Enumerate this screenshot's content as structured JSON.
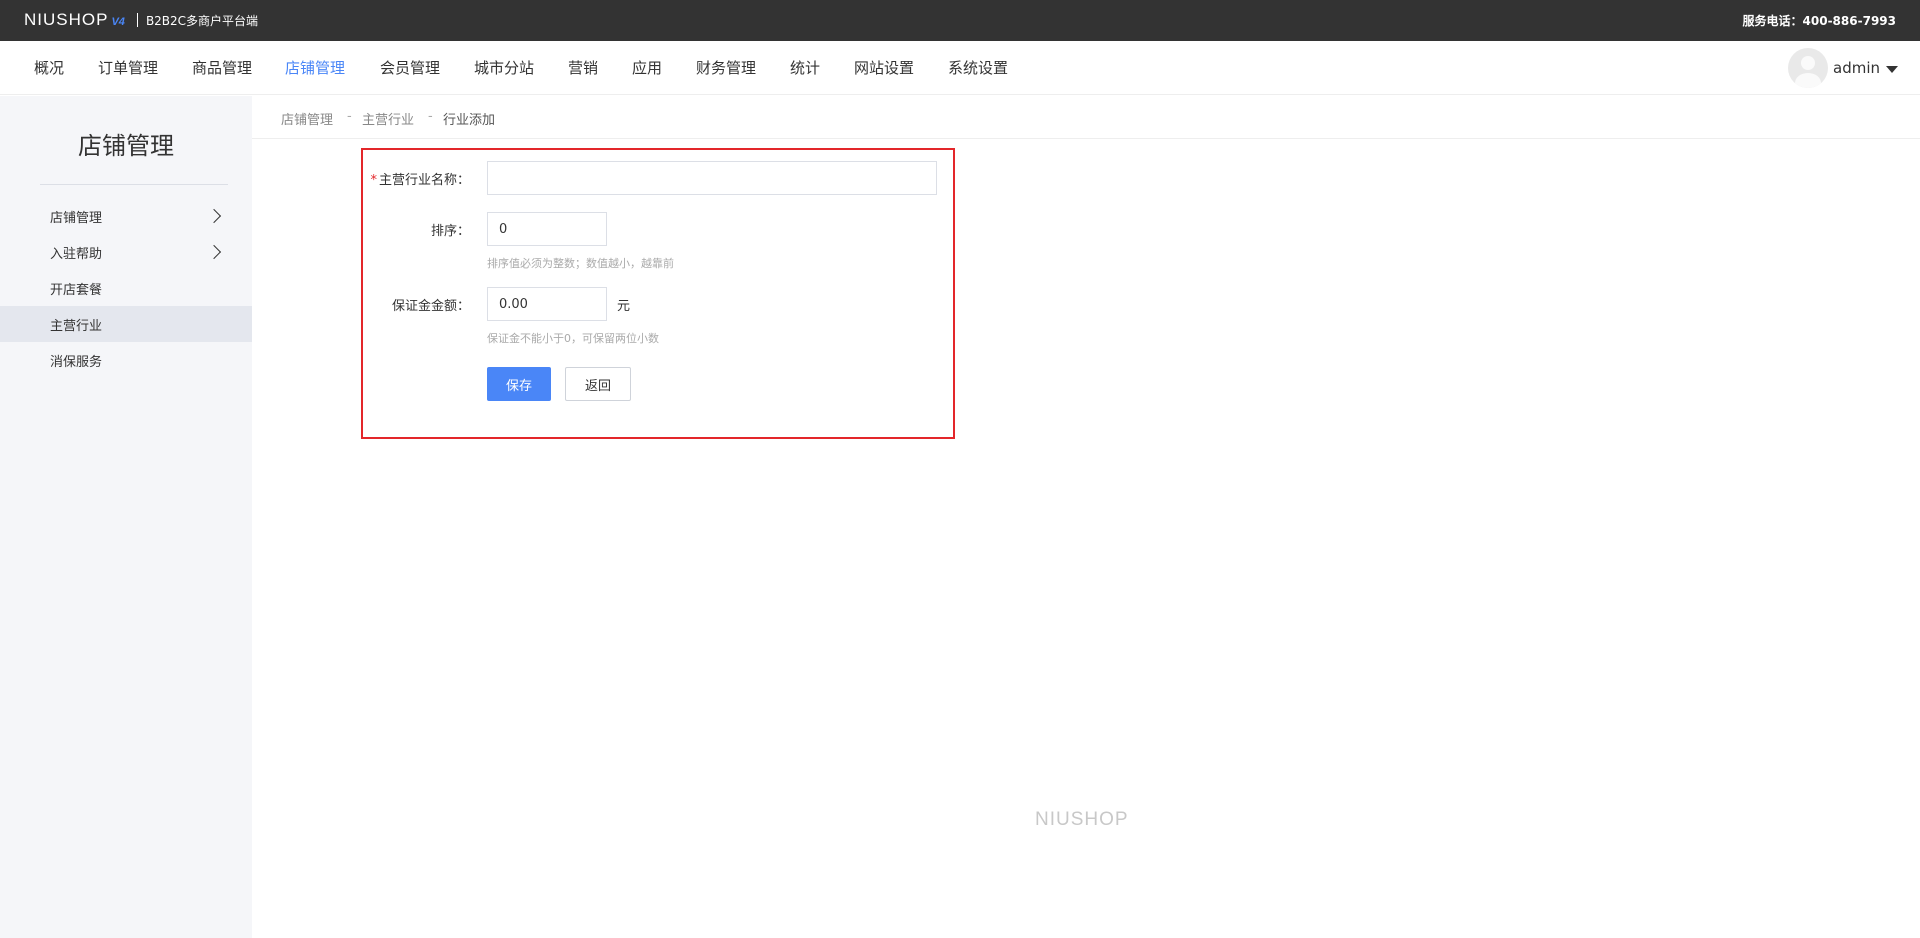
{
  "topbar": {
    "logo_text": "NIUSHOP",
    "logo_version": "V4",
    "subtitle": "B2B2C多商户平台端",
    "hotline": "服务电话：400-886-7993"
  },
  "nav": {
    "items": [
      "概况",
      "订单管理",
      "商品管理",
      "店铺管理",
      "会员管理",
      "城市分站",
      "营销",
      "应用",
      "财务管理",
      "统计",
      "网站设置",
      "系统设置"
    ],
    "active": "店铺管理",
    "user_name": "admin"
  },
  "sidebar": {
    "title": "店铺管理",
    "items": [
      {
        "label": "店铺管理",
        "has_children": true
      },
      {
        "label": "入驻帮助",
        "has_children": true
      },
      {
        "label": "开店套餐",
        "has_children": false
      },
      {
        "label": "主营行业",
        "has_children": false,
        "active": true
      },
      {
        "label": "消保服务",
        "has_children": false
      }
    ]
  },
  "breadcrumb": {
    "items": [
      "店铺管理",
      "主营行业",
      "行业添加"
    ],
    "separator": "-"
  },
  "form": {
    "name_label": "主营行业名称：",
    "name_required_mark": "*",
    "name_value": "",
    "sort_label": "排序：",
    "sort_value": "0",
    "sort_hint": "排序值必须为整数；数值越小，越靠前",
    "deposit_label": "保证金金额：",
    "deposit_value": "0.00",
    "deposit_unit": "元",
    "deposit_hint": "保证金不能小于0，可保留两位小数",
    "save_label": "保存",
    "back_label": "返回"
  },
  "footer": {
    "watermark": "NIUSHOP"
  },
  "colors": {
    "topbar_bg": "#333333",
    "accent": "#4a86f7",
    "highlight_border": "#e3262a",
    "sidebar_bg": "#f5f6f9",
    "sidebar_active_bg": "#e4e7ee"
  }
}
